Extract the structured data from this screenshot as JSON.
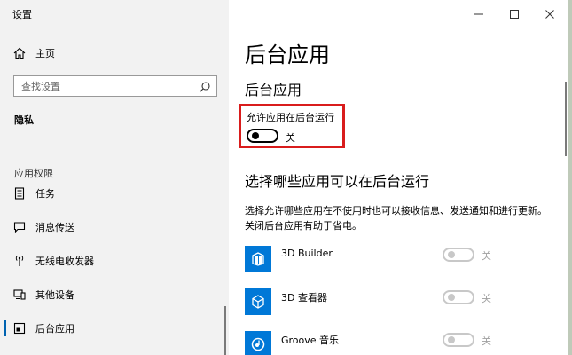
{
  "window": {
    "title": "设置"
  },
  "sidebar": {
    "home_label": "主页",
    "search_placeholder": "查找设置",
    "current_section": "隐私",
    "group_label": "应用权限",
    "items": [
      {
        "label": "任务",
        "icon": "tasks-icon"
      },
      {
        "label": "消息传送",
        "icon": "message-icon"
      },
      {
        "label": "无线电收发器",
        "icon": "radio-icon"
      },
      {
        "label": "其他设备",
        "icon": "devices-icon"
      },
      {
        "label": "后台应用",
        "icon": "background-apps-icon",
        "active": true
      }
    ]
  },
  "main": {
    "page_title": "后台应用",
    "subtitle": "后台应用",
    "allow_label": "允许应用在后台运行",
    "allow_state": "关",
    "section_title": "选择哪些应用可以在后台运行",
    "description": "选择允许哪些应用在不使用时也可以接收信息、发送通知和进行更新。关闭后台应用有助于省电。",
    "apps": [
      {
        "name": "3D Builder",
        "state": "关",
        "icon": "3d-builder-icon"
      },
      {
        "name": "3D 查看器",
        "state": "关",
        "icon": "3d-viewer-icon"
      },
      {
        "name": "Groove 音乐",
        "state": "关",
        "icon": "groove-music-icon"
      }
    ]
  },
  "colors": {
    "accent": "#0078d7",
    "highlight": "#d91c1c",
    "sidebar_bg": "#f2f2f2"
  }
}
